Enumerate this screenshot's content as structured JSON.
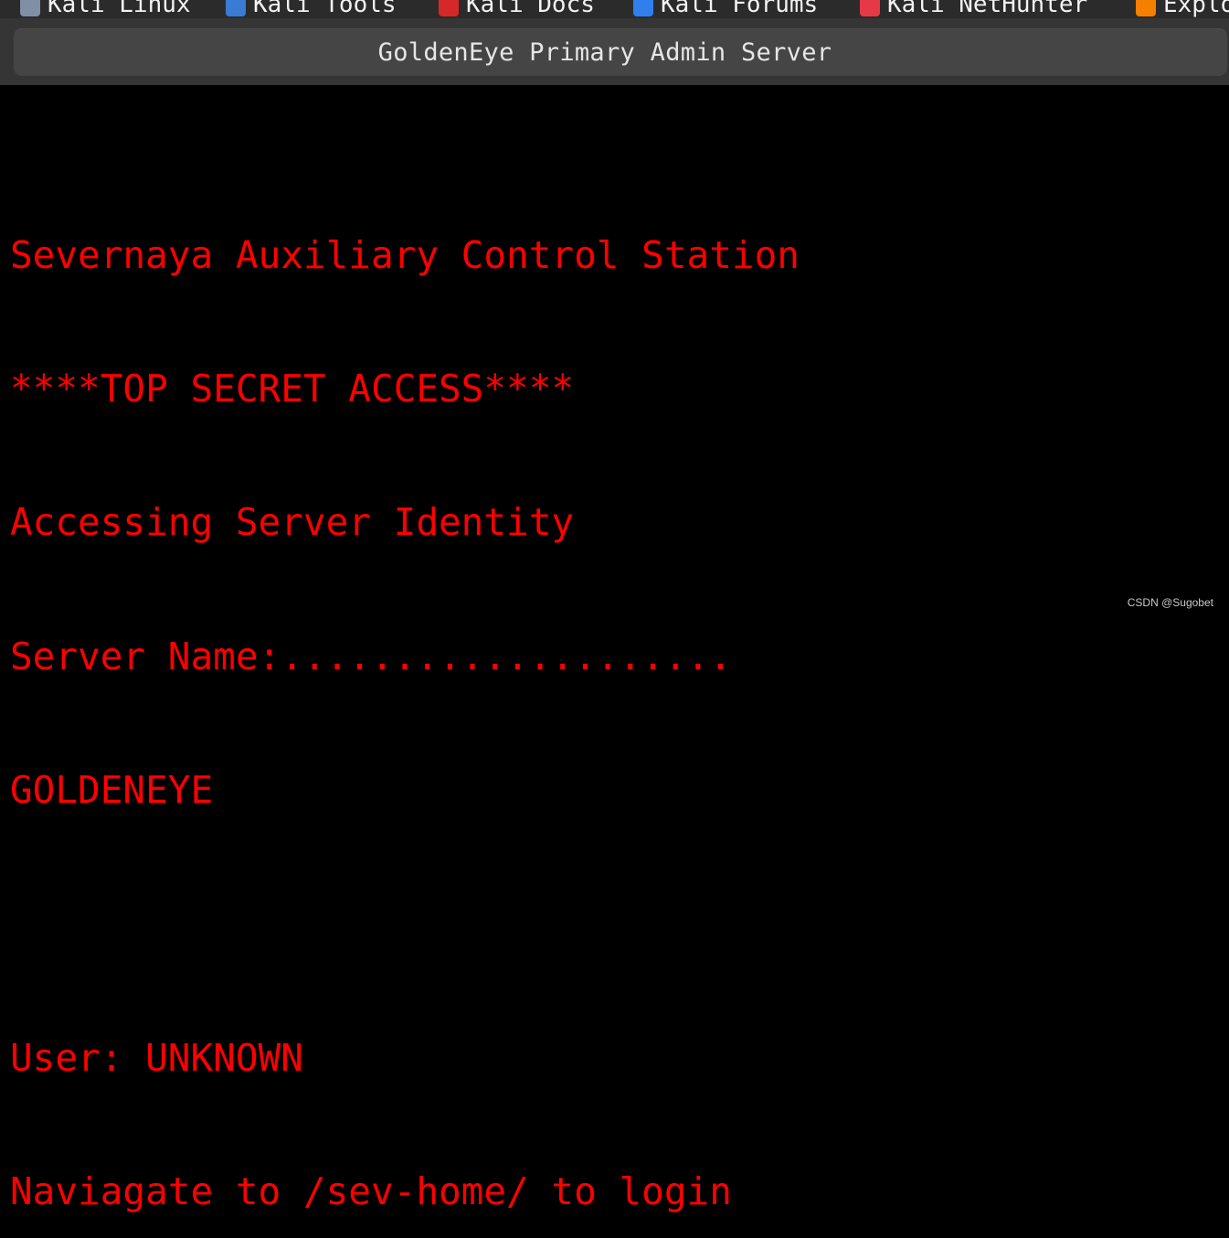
{
  "bookmarks": [
    {
      "label": "Kali Linux",
      "icon": "kali-dragon-icon",
      "color": "#7f8fa6"
    },
    {
      "label": "Kali Tools",
      "icon": "kali-tools-icon",
      "color": "#3a7bd5"
    },
    {
      "label": "Kali Docs",
      "icon": "kali-docs-icon",
      "color": "#d62828"
    },
    {
      "label": "Kali Forums",
      "icon": "kali-forums-icon",
      "color": "#2f80ed"
    },
    {
      "label": "Kali NetHunter",
      "icon": "kali-nethunter-icon",
      "color": "#e63946"
    },
    {
      "label": "Explo",
      "icon": "exploit-db-icon",
      "color": "#f77f00"
    }
  ],
  "window": {
    "title": "GoldenEye Primary Admin Server"
  },
  "terminal": {
    "lines": [
      "Severnaya Auxiliary Control Station",
      "****TOP SECRET ACCESS****",
      "Accessing Server Identity",
      "Server Name:....................",
      "GOLDENEYE",
      "",
      "User: UNKNOWN",
      "Naviagate to /sev-home/ to login"
    ],
    "text_color": "#ff0000",
    "background": "#000000"
  },
  "watermark": "CSDN @Sugobet"
}
